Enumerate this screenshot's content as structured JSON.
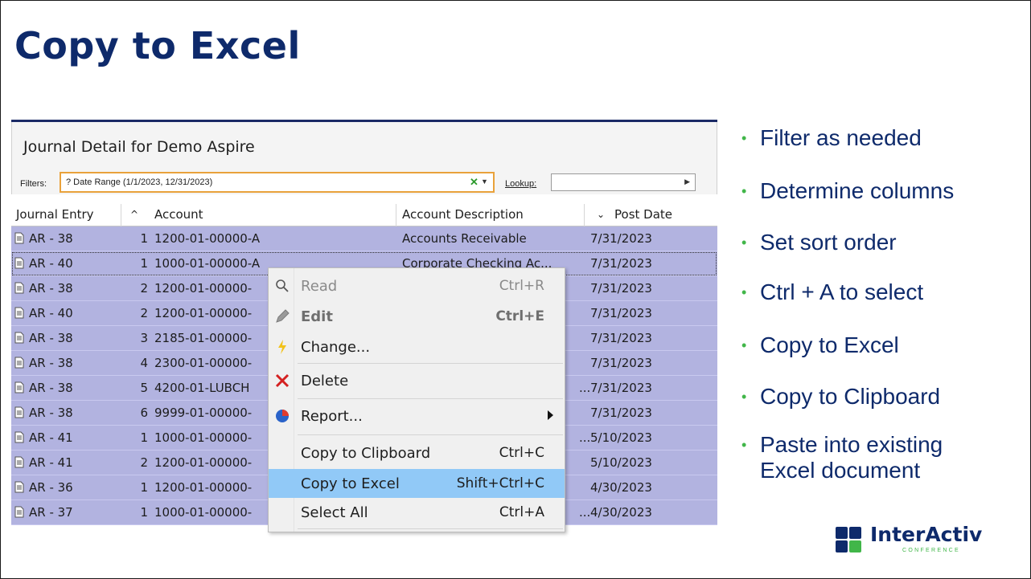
{
  "slide": {
    "title": "Copy to Excel",
    "bullets": [
      "Filter as needed",
      "Determine columns",
      "Set sort order",
      "Ctrl + A to select",
      "Copy to Excel",
      "Copy to Clipboard",
      "Paste into existing Excel document"
    ],
    "logo": {
      "name": "InterActiv",
      "sub": "CONFERENCE"
    }
  },
  "app": {
    "title": "Journal Detail for Demo Aspire",
    "filters_label": "Filters:",
    "filter_value": "? Date Range (1/1/2023, 12/31/2023)",
    "lookup_label": "Lookup:",
    "lookup_value": "",
    "columns": {
      "journal_entry": "Journal Entry",
      "account": "Account",
      "account_description": "Account Description",
      "post_date": "Post Date"
    },
    "rows": [
      {
        "entry": "AR - 38",
        "line": "1",
        "account": "1200-01-00000-A",
        "description": "Accounts Receivable",
        "post_date": "7/31/2023"
      },
      {
        "entry": "AR - 40",
        "line": "1",
        "account": "1000-01-00000-A",
        "description": "Corporate Checking Ac...",
        "post_date": "7/31/2023"
      },
      {
        "entry": "AR - 38",
        "line": "2",
        "account": "1200-01-00000-",
        "description": "",
        "post_date": "7/31/2023"
      },
      {
        "entry": "AR - 40",
        "line": "2",
        "account": "1200-01-00000-",
        "description": "",
        "post_date": "7/31/2023"
      },
      {
        "entry": "AR - 38",
        "line": "3",
        "account": "2185-01-00000-",
        "description": "",
        "post_date": "7/31/2023"
      },
      {
        "entry": "AR - 38",
        "line": "4",
        "account": "2300-01-00000-",
        "description": "",
        "post_date": "7/31/2023"
      },
      {
        "entry": "AR - 38",
        "line": "5",
        "account": "4200-01-LUBCH",
        "description": "...",
        "post_date": "7/31/2023"
      },
      {
        "entry": "AR - 38",
        "line": "6",
        "account": "9999-01-00000-",
        "description": "",
        "post_date": "7/31/2023"
      },
      {
        "entry": "AR - 41",
        "line": "1",
        "account": "1000-01-00000-",
        "description": "...",
        "post_date": "5/10/2023"
      },
      {
        "entry": "AR - 41",
        "line": "2",
        "account": "1200-01-00000-",
        "description": "",
        "post_date": "5/10/2023"
      },
      {
        "entry": "AR - 36",
        "line": "1",
        "account": "1200-01-00000-",
        "description": "",
        "post_date": "4/30/2023"
      },
      {
        "entry": "AR - 37",
        "line": "1",
        "account": "1000-01-00000-",
        "description": "...",
        "post_date": "4/30/2023"
      }
    ],
    "context_menu": [
      {
        "label": "Read",
        "shortcut": "Ctrl+R",
        "icon": "search-icon"
      },
      {
        "label": "Edit",
        "shortcut": "Ctrl+E",
        "icon": "pencil-icon"
      },
      {
        "label": "Change...",
        "shortcut": "",
        "icon": "lightning-icon"
      },
      {
        "label": "Delete",
        "shortcut": "",
        "icon": "delete-x-icon"
      },
      {
        "label": "Report...",
        "shortcut": "",
        "icon": "pie-chart-icon"
      },
      {
        "label": "Copy to Clipboard",
        "shortcut": "Ctrl+C",
        "icon": ""
      },
      {
        "label": "Copy to Excel",
        "shortcut": "Shift+Ctrl+C",
        "icon": ""
      },
      {
        "label": "Select All",
        "shortcut": "Ctrl+A",
        "icon": ""
      }
    ]
  },
  "colors": {
    "title": "#0e2a6b",
    "accent": "#41b649",
    "row_selected": "#b2b3e0",
    "menu_highlight": "#91c9f7",
    "filter_border": "#e9a23b"
  }
}
